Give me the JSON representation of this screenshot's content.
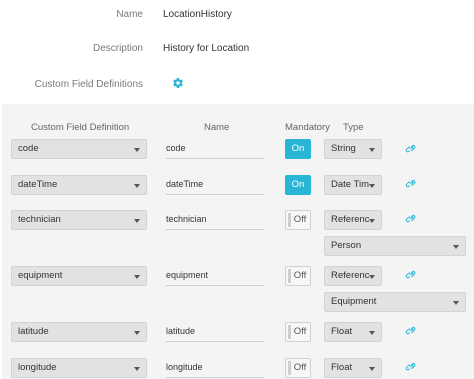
{
  "properties": {
    "name_label": "Name",
    "name_value": "LocationHistory",
    "description_label": "Description",
    "description_value": "History for Location",
    "cfd_label": "Custom Field Definitions"
  },
  "table": {
    "headers": {
      "definition": "Custom Field Definition",
      "name": "Name",
      "mandatory": "Mandatory",
      "type": "Type"
    },
    "rows": [
      {
        "definition": "code",
        "name": "code",
        "mandatory": "On",
        "type": "String"
      },
      {
        "definition": "dateTime",
        "name": "dateTime",
        "mandatory": "On",
        "type": "Date Tim"
      },
      {
        "definition": "technician",
        "name": "technician",
        "mandatory": "Off",
        "type": "Referenc",
        "reference": "Person"
      },
      {
        "definition": "equipment",
        "name": "equipment",
        "mandatory": "Off",
        "type": "Referenc",
        "reference": "Equipment"
      },
      {
        "definition": "latitude",
        "name": "latitude",
        "mandatory": "Off",
        "type": "Float"
      },
      {
        "definition": "longitude",
        "name": "longitude",
        "mandatory": "Off",
        "type": "Float"
      }
    ]
  },
  "colors": {
    "accent": "#29b6d6",
    "panel": "#f4f4f4",
    "select": "#e2e2e2"
  },
  "icons": {
    "settings": "gear-icon",
    "link": "link-icon",
    "dropdown": "chevron-down-icon"
  }
}
